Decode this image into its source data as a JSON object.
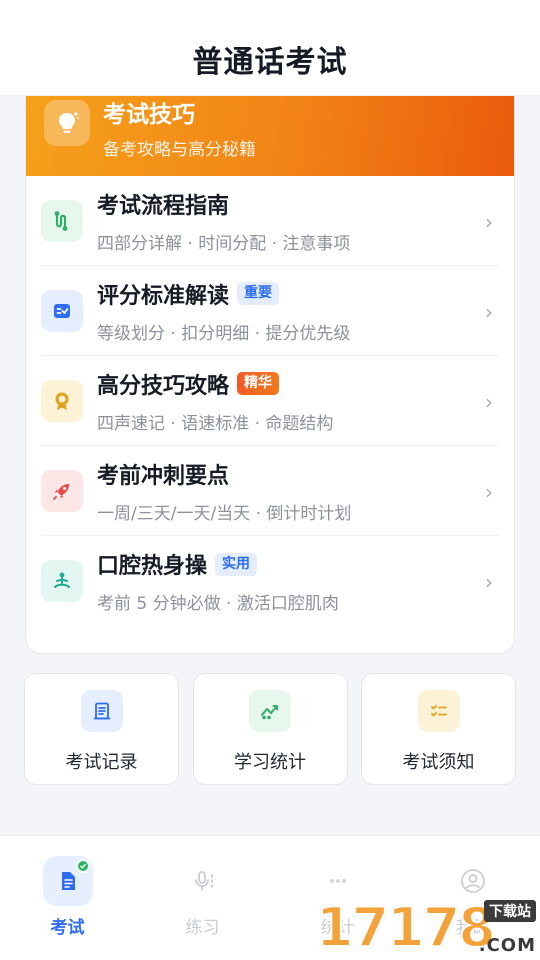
{
  "header": {
    "title": "普通话考试"
  },
  "banner": {
    "title": "考试技巧",
    "subtitle": "备考攻略与高分秘籍",
    "icon": "lightbulb-icon"
  },
  "list": [
    {
      "title": "考试流程指南",
      "subtitle": "四部分详解 · 时间分配 · 注意事项",
      "badge": "",
      "icon": "route-icon",
      "color": "#2fae6b",
      "bg": "#e8f7ee"
    },
    {
      "title": "评分标准解读",
      "subtitle": "等级划分 · 扣分明细 · 提分优先级",
      "badge": "重要",
      "icon": "checklist-icon",
      "color": "#2f6df0",
      "bg": "#e5eeff"
    },
    {
      "title": "高分技巧攻略",
      "subtitle": "四声速记 · 语速标准 · 命题结构",
      "badge": "精华",
      "icon": "award-icon",
      "color": "#e0a21a",
      "bg": "#fdf1d6"
    },
    {
      "title": "考前冲刺要点",
      "subtitle": "一周/三天/一天/当天 · 倒计时计划",
      "badge": "",
      "icon": "rocket-icon",
      "color": "#e84848",
      "bg": "#fde6e6"
    },
    {
      "title": "口腔热身操",
      "subtitle": "考前 5 分钟必做 · 激活口腔肌肉",
      "badge": "实用",
      "icon": "meditation-icon",
      "color": "#1faa92",
      "bg": "#e4f6f1"
    }
  ],
  "tiles": [
    {
      "label": "考试记录",
      "icon": "record-book-icon",
      "color": "#2f6df0",
      "bg": "#e5eeff"
    },
    {
      "label": "学习统计",
      "icon": "trend-chart-icon",
      "color": "#2fae6b",
      "bg": "#e8f7ee"
    },
    {
      "label": "考试须知",
      "icon": "notice-list-icon",
      "color": "#e0a21a",
      "bg": "#fdf1d6"
    }
  ],
  "tabs": [
    {
      "label": "考试",
      "active": true,
      "icon": "exam-doc-icon"
    },
    {
      "label": "练习",
      "active": false,
      "icon": "microphone-icon"
    },
    {
      "label": "统计",
      "active": false,
      "icon": "dots-icon"
    },
    {
      "label": "我的",
      "active": false,
      "icon": "user-icon"
    }
  ],
  "watermark": {
    "number": "17178",
    "tag": "下载站",
    "domain": ".COM"
  },
  "colors": {
    "accent": "#2f6df0",
    "banner_start": "#f5a11a",
    "banner_end": "#ea5a0d"
  }
}
